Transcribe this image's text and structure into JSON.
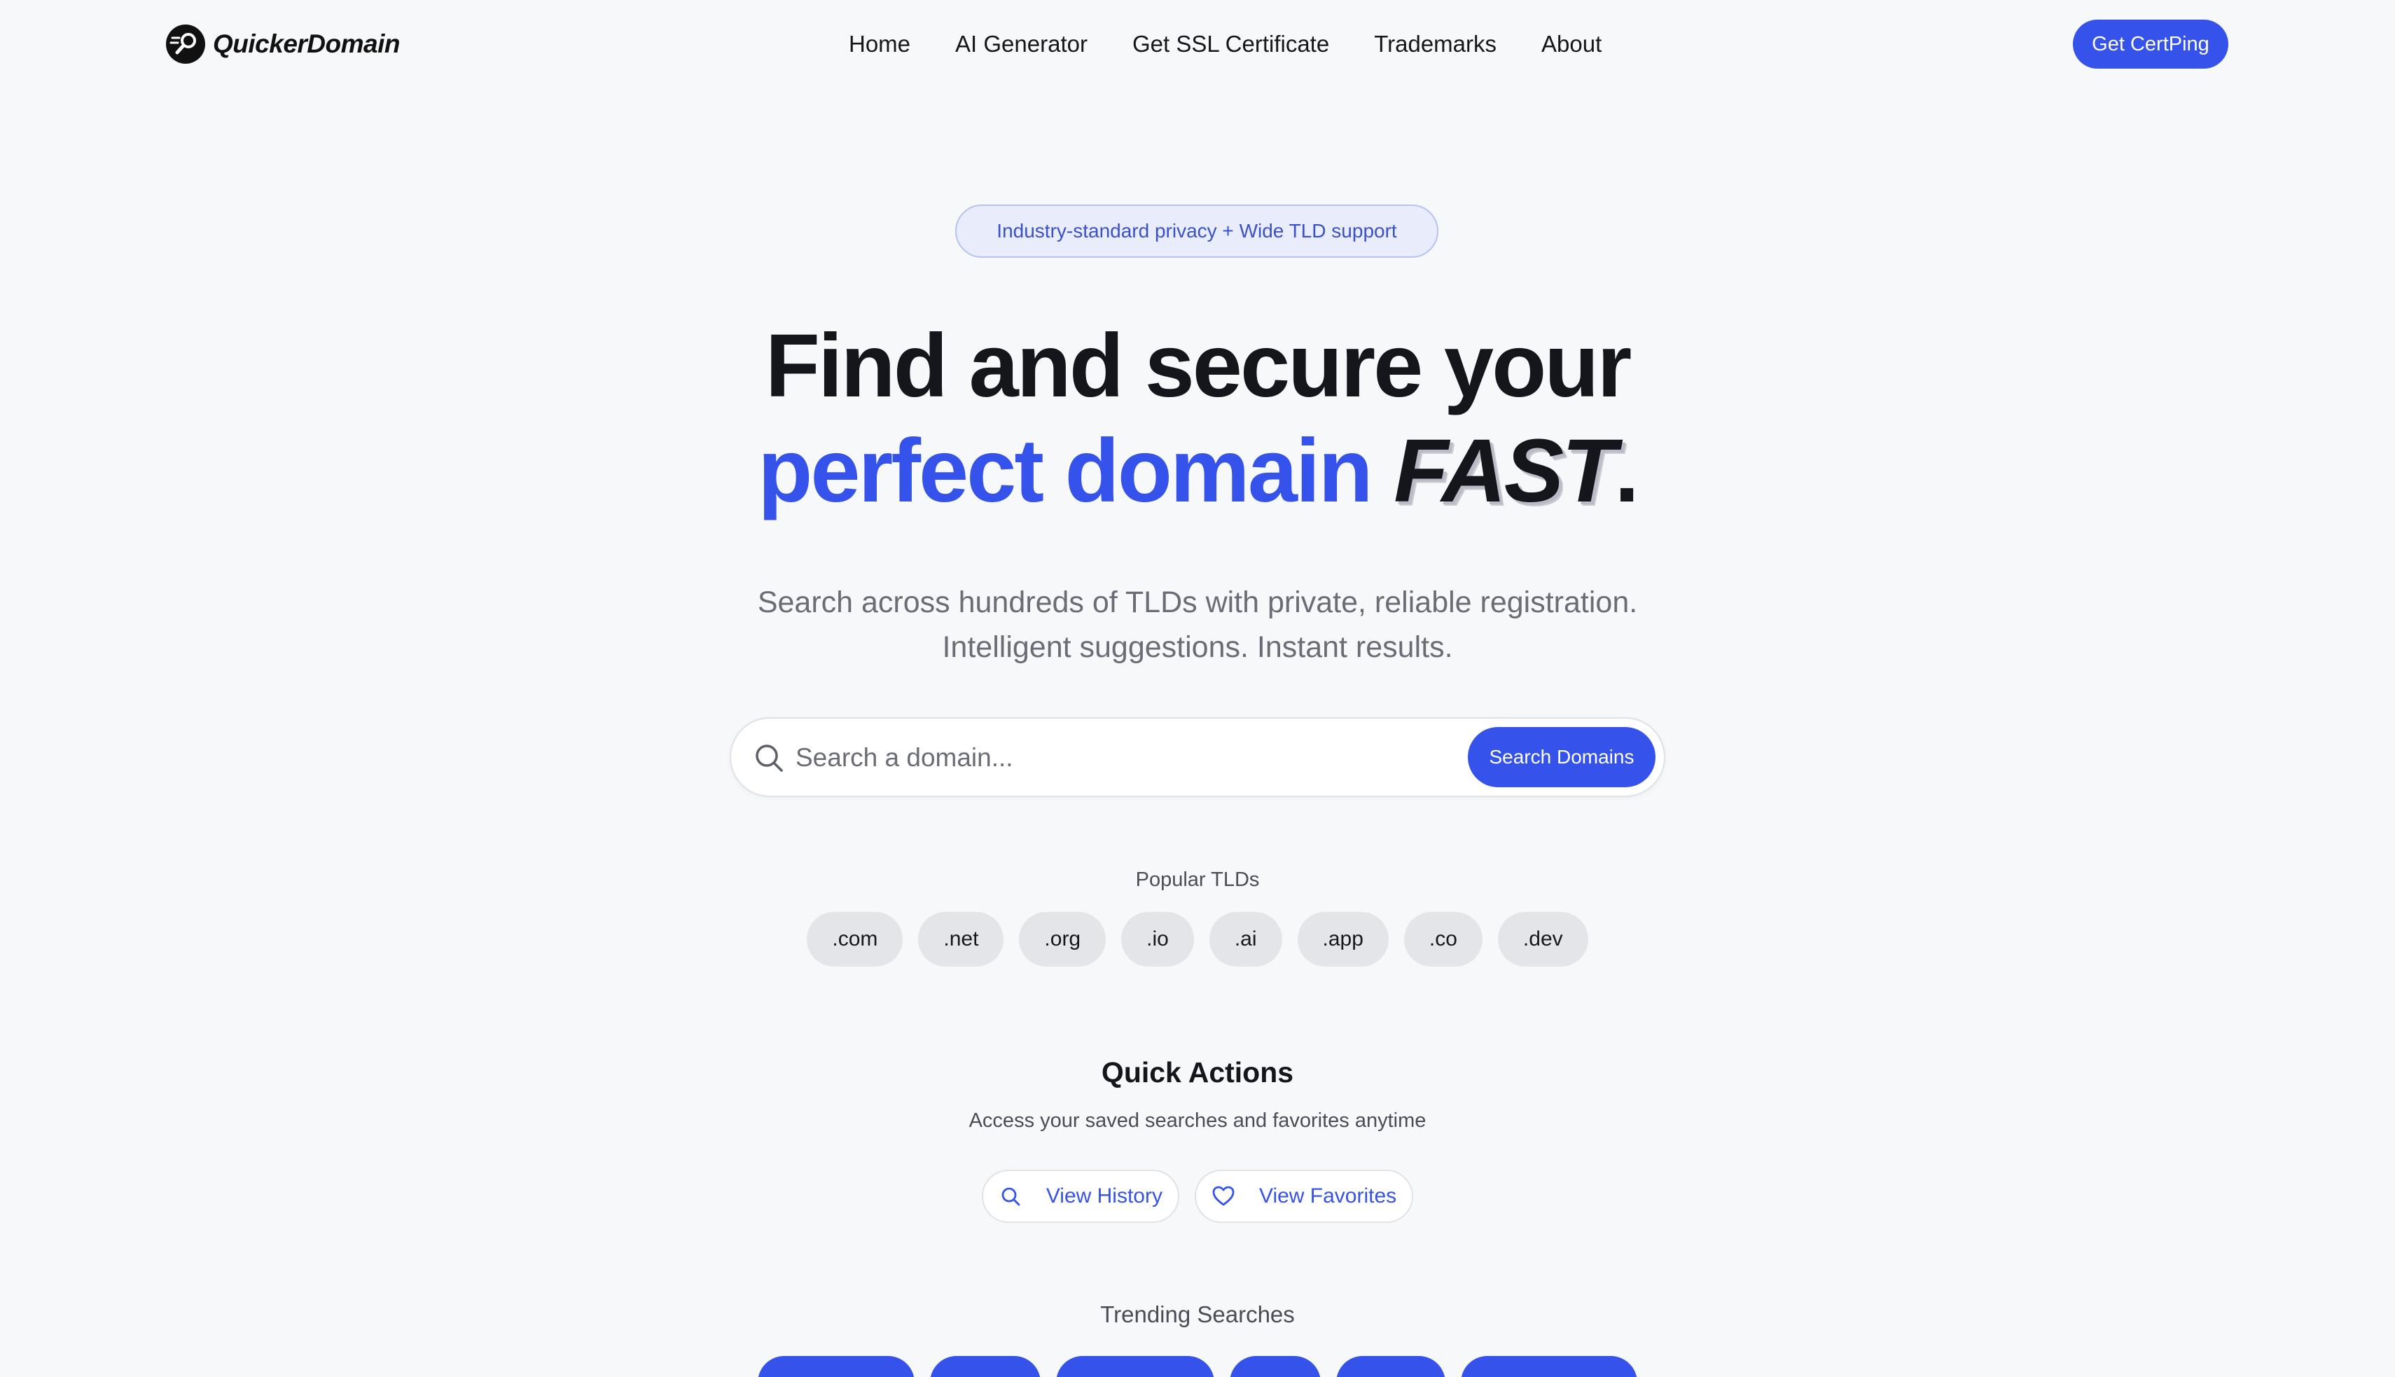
{
  "brand": {
    "name": "QuickerDomain",
    "accent": "#3553ea"
  },
  "nav": {
    "items": [
      "Home",
      "AI Generator",
      "Get SSL Certificate",
      "Trademarks",
      "About"
    ],
    "cta_label": "Get CertPing"
  },
  "hero": {
    "badge": "Industry-standard privacy + Wide TLD support",
    "title_line1": "Find and secure your",
    "title_highlight": "perfect domain",
    "title_emphasis": "FAST",
    "title_period": ".",
    "subtitle_line1": "Search across hundreds of TLDs with private, reliable registration.",
    "subtitle_line2": "Intelligent suggestions. Instant results."
  },
  "search": {
    "placeholder": "Search a domain...",
    "value": "",
    "button_label": "Search Domains",
    "icon": "search-icon"
  },
  "popular_tlds": {
    "label": "Popular TLDs",
    "items": [
      ".com",
      ".net",
      ".org",
      ".io",
      ".ai",
      ".app",
      ".co",
      ".dev"
    ]
  },
  "quick_actions": {
    "title": "Quick Actions",
    "subtitle": "Access your saved searches and favorites anytime",
    "history_label": "View History",
    "history_icon": "search-icon",
    "favorites_label": "View Favorites",
    "favorites_icon": "heart-icon"
  },
  "trending": {
    "label": "Trending Searches"
  }
}
